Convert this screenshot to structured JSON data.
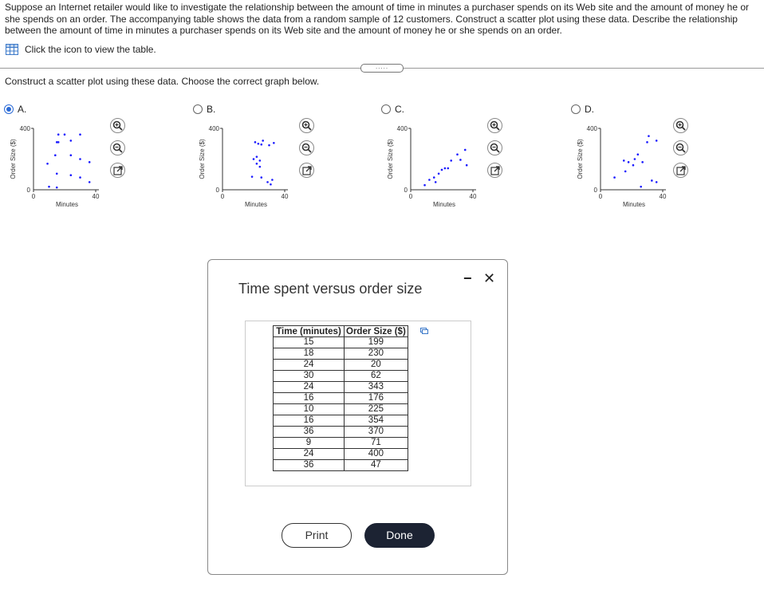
{
  "question": {
    "text": "Suppose an Internet retailer would like to investigate the relationship between the amount of time in minutes a purchaser spends on its Web site and the amount of money he or she spends on an order. The accompanying table shows the data from a random sample of 12 customers. Construct a scatter plot using these data. Describe the relationship between the amount of time in minutes a purchaser spends on its Web site and the amount of money he or she spends on an order.",
    "table_link": "Click the icon to view the table.",
    "more_label": ".....",
    "prompt": "Construct a scatter plot using these data. Choose the correct graph below."
  },
  "options": [
    {
      "label": "A.",
      "selected": true,
      "points": [
        [
          15,
          310
        ],
        [
          16,
          360
        ],
        [
          16,
          310
        ],
        [
          20,
          360
        ],
        [
          24,
          320
        ],
        [
          30,
          360
        ],
        [
          9,
          170
        ],
        [
          14,
          225
        ],
        [
          15,
          105
        ],
        [
          24,
          225
        ],
        [
          30,
          200
        ],
        [
          36,
          180
        ],
        [
          10,
          20
        ],
        [
          15,
          15
        ],
        [
          24,
          95
        ],
        [
          30,
          80
        ],
        [
          36,
          50
        ]
      ]
    },
    {
      "label": "B.",
      "selected": false,
      "points": [
        [
          21,
          310
        ],
        [
          23,
          300
        ],
        [
          25,
          295
        ],
        [
          26,
          320
        ],
        [
          30,
          290
        ],
        [
          33,
          305
        ],
        [
          20,
          200
        ],
        [
          22,
          215
        ],
        [
          22,
          170
        ],
        [
          24,
          190
        ],
        [
          24,
          150
        ],
        [
          19,
          85
        ],
        [
          25,
          80
        ],
        [
          29,
          50
        ],
        [
          31,
          35
        ],
        [
          32,
          65
        ]
      ]
    },
    {
      "label": "C.",
      "selected": false,
      "points": [
        [
          9,
          30
        ],
        [
          12,
          65
        ],
        [
          15,
          80
        ],
        [
          16,
          50
        ],
        [
          18,
          105
        ],
        [
          20,
          130
        ],
        [
          22,
          140
        ],
        [
          24,
          140
        ],
        [
          26,
          190
        ],
        [
          30,
          230
        ],
        [
          32,
          195
        ],
        [
          36,
          160
        ],
        [
          35,
          260
        ]
      ]
    },
    {
      "label": "D.",
      "selected": false,
      "points": [
        [
          15,
          190
        ],
        [
          18,
          180
        ],
        [
          21,
          160
        ],
        [
          22,
          200
        ],
        [
          24,
          230
        ],
        [
          27,
          180
        ],
        [
          30,
          310
        ],
        [
          36,
          320
        ],
        [
          31,
          350
        ],
        [
          16,
          120
        ],
        [
          9,
          80
        ],
        [
          26,
          20
        ],
        [
          33,
          60
        ],
        [
          36,
          50
        ]
      ]
    }
  ],
  "plot_labels": {
    "y_top": "400",
    "y_zero": "0",
    "x_zero": "0",
    "x_end": "40",
    "x_title": "Minutes",
    "y_title": "Order Size ($)"
  },
  "dialog": {
    "title": "Time spent versus order size",
    "headers": [
      "Time (minutes)",
      "Order Size ($)"
    ],
    "rows": [
      [
        "15",
        "199"
      ],
      [
        "18",
        "230"
      ],
      [
        "24",
        "20"
      ],
      [
        "30",
        "62"
      ],
      [
        "24",
        "343"
      ],
      [
        "16",
        "176"
      ],
      [
        "10",
        "225"
      ],
      [
        "16",
        "354"
      ],
      [
        "36",
        "370"
      ],
      [
        "9",
        "71"
      ],
      [
        "24",
        "400"
      ],
      [
        "36",
        "47"
      ]
    ],
    "print_label": "Print",
    "done_label": "Done",
    "close_symbol": "✕",
    "minimize_symbol": "−"
  },
  "colors": {
    "point": "#1a1aff",
    "accent": "#2a6ad6",
    "done_bg": "#1c2333"
  }
}
